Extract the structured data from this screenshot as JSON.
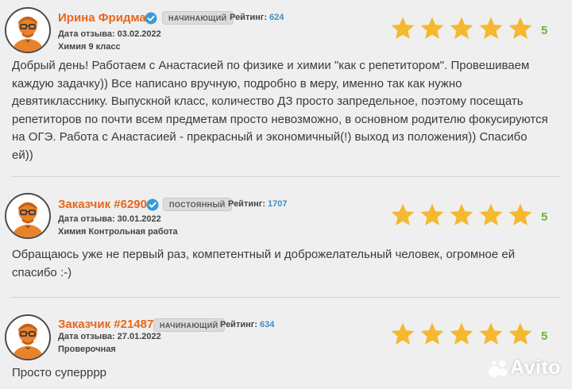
{
  "accent_colors": {
    "name": "#e8671b",
    "rating_value": "#3a8fc7",
    "score": "#6db33f",
    "star": "#f5b82e"
  },
  "reviews": [
    {
      "name": "Ирина Фридман",
      "verified_icon": "verified-check-icon",
      "badge": "НАЧИНАЮЩИЙ",
      "rating_label": "Рейтинг:",
      "rating_value": "624",
      "date": "Дата отзыва: 03.02.2022",
      "subject": "Химия 9 класс",
      "stars": 5,
      "score": "5",
      "text_lines": [
        "Добрый день! Работаем с Анастасией по физике и химии \"как с репетитором\". Провешиваем",
        "каждую задачку)) Все написано вручную, подробно в меру, именно так как нужно",
        "девятикласснику. Выпускной класс, количество ДЗ просто запредельное, поэтому посещать",
        "репетиторов по почти всем предметам просто невозможно, в основном родителю фокусируются",
        "на ОГЭ. Работа с Анастасией - прекрасный и экономичный(!) выход из положения)) Спасибо",
        "ей))"
      ]
    },
    {
      "name": "Заказчик #62909",
      "verified_icon": "verified-check-icon",
      "badge": "ПОСТОЯННЫЙ",
      "rating_label": "Рейтинг:",
      "rating_value": "1707",
      "date": "Дата отзыва: 30.01.2022",
      "subject": "Химия Контрольная работа",
      "stars": 5,
      "score": "5",
      "text_lines": [
        "Обращаюсь уже не первый раз, компетентный и доброжелательный человек, огромное ей",
        "спасибо :-)"
      ]
    },
    {
      "name": "Заказчик #214875",
      "badge": "НАЧИНАЮЩИЙ",
      "rating_label": "Рейтинг:",
      "rating_value": "634",
      "date": "Дата отзыва: 27.01.2022",
      "subject": "Проверочная",
      "stars": 5,
      "score": "5",
      "text_lines": [
        "Просто суперррр"
      ]
    }
  ],
  "watermark": {
    "text": "Avito",
    "icon": "avito-dots-icon"
  }
}
